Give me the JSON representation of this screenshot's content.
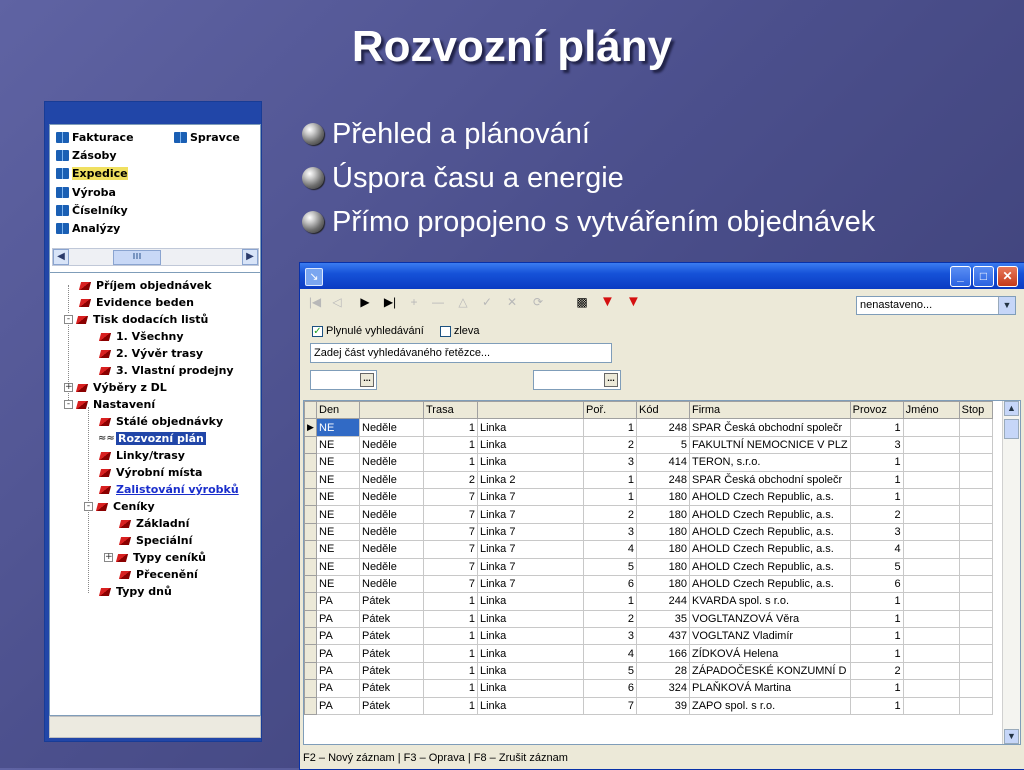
{
  "slide": {
    "title": "Rozvozní plány",
    "bullets": [
      "Přehled a plánování",
      "Úspora času a energie",
      "Přímo propojeno s vytvářením objednávek"
    ]
  },
  "modules": {
    "items": [
      {
        "label": "Fakturace"
      },
      {
        "label": "Spravce"
      },
      {
        "label": "Zásoby"
      },
      {
        "label": "Expedice",
        "selected": true
      },
      {
        "label": "Výroba"
      },
      {
        "label": "Číselníky"
      },
      {
        "label": "Analýzy"
      }
    ],
    "scroll_thumb": "III"
  },
  "tree": {
    "nodes": [
      {
        "label": "Příjem objednávek"
      },
      {
        "label": "Evidence beden"
      },
      {
        "label": "Tisk dodacích listů",
        "expander": "-"
      },
      {
        "label": "1. Všechny"
      },
      {
        "label": "2. Vývěr trasy"
      },
      {
        "label": "3. Vlastní prodejny"
      },
      {
        "label": "Výběry z DL",
        "expander": "+"
      },
      {
        "label": "Nastavení",
        "expander": "-"
      },
      {
        "label": "Stálé objednávky"
      },
      {
        "label": "Rozvozní plán",
        "selected": true
      },
      {
        "label": "Linky/trasy"
      },
      {
        "label": "Výrobní místa"
      },
      {
        "label": "Zalistování výrobků",
        "link": true
      },
      {
        "label": "Ceníky",
        "expander": "-"
      },
      {
        "label": "Základní"
      },
      {
        "label": "Speciální"
      },
      {
        "label": "Typy ceníků",
        "expander": "+"
      },
      {
        "label": "Přecenění"
      },
      {
        "label": "Typy dnů"
      }
    ]
  },
  "window": {
    "combo_value": "nenastaveno...",
    "filter": {
      "continuous_label": "Plynulé vyhledávání",
      "continuous_checked": true,
      "left_label": "zleva",
      "left_checked": false
    },
    "search_placeholder": "Zadej část vyhledávaného řetězce...",
    "picker_btn": "...",
    "toolbar_icons": [
      "first-icon",
      "prev-icon",
      "next-icon",
      "last-icon",
      "insert-icon",
      "delete-icon",
      "edit-icon",
      "confirm-icon",
      "cancel-icon",
      "refresh-icon",
      "export-icon",
      "filter-icon",
      "clear-filter-icon"
    ],
    "status": "F2 – Nový záznam | F3 – Oprava | F8 – Zrušit záznam"
  },
  "grid": {
    "columns": [
      "Den",
      "",
      "Trasa",
      "",
      "Poř.",
      "Kód",
      "Firma",
      "Provoz",
      "Jméno",
      "Stop"
    ],
    "rows": [
      [
        "NE",
        "Neděle",
        "1",
        "Linka",
        "1",
        "248",
        "SPAR Česká obchodní společr",
        "1",
        "",
        ""
      ],
      [
        "NE",
        "Neděle",
        "1",
        "Linka",
        "2",
        "5",
        "FAKULTNÍ NEMOCNICE V PLZ",
        "3",
        "",
        ""
      ],
      [
        "NE",
        "Neděle",
        "1",
        "Linka",
        "3",
        "414",
        "TERON, s.r.o.",
        "1",
        "",
        ""
      ],
      [
        "NE",
        "Neděle",
        "2",
        "Linka 2",
        "1",
        "248",
        "SPAR Česká obchodní společr",
        "1",
        "",
        ""
      ],
      [
        "NE",
        "Neděle",
        "7",
        "Linka 7",
        "1",
        "180",
        "AHOLD Czech Republic, a.s.",
        "1",
        "",
        ""
      ],
      [
        "NE",
        "Neděle",
        "7",
        "Linka 7",
        "2",
        "180",
        "AHOLD Czech Republic, a.s.",
        "2",
        "",
        ""
      ],
      [
        "NE",
        "Neděle",
        "7",
        "Linka 7",
        "3",
        "180",
        "AHOLD Czech Republic, a.s.",
        "3",
        "",
        ""
      ],
      [
        "NE",
        "Neděle",
        "7",
        "Linka 7",
        "4",
        "180",
        "AHOLD Czech Republic, a.s.",
        "4",
        "",
        ""
      ],
      [
        "NE",
        "Neděle",
        "7",
        "Linka 7",
        "5",
        "180",
        "AHOLD Czech Republic, a.s.",
        "5",
        "",
        ""
      ],
      [
        "NE",
        "Neděle",
        "7",
        "Linka 7",
        "6",
        "180",
        "AHOLD Czech Republic, a.s.",
        "6",
        "",
        ""
      ],
      [
        "PA",
        "Pátek",
        "1",
        "Linka",
        "1",
        "244",
        "KVARDA spol. s r.o.",
        "1",
        "",
        ""
      ],
      [
        "PA",
        "Pátek",
        "1",
        "Linka",
        "2",
        "35",
        "VOGLTANZOVÁ Věra",
        "1",
        "",
        ""
      ],
      [
        "PA",
        "Pátek",
        "1",
        "Linka",
        "3",
        "437",
        "VOGLTANZ Vladimír",
        "1",
        "",
        ""
      ],
      [
        "PA",
        "Pátek",
        "1",
        "Linka",
        "4",
        "166",
        "ZÍDKOVÁ Helena",
        "1",
        "",
        ""
      ],
      [
        "PA",
        "Pátek",
        "1",
        "Linka",
        "5",
        "28",
        "ZÁPADOČESKÉ KONZUMNÍ D",
        "2",
        "",
        ""
      ],
      [
        "PA",
        "Pátek",
        "1",
        "Linka",
        "6",
        "324",
        "PLAŇKOVÁ Martina",
        "1",
        "",
        ""
      ],
      [
        "PA",
        "Pátek",
        "1",
        "Linka",
        "7",
        "39",
        "ZAPO spol. s r.o.",
        "1",
        "",
        ""
      ]
    ]
  }
}
